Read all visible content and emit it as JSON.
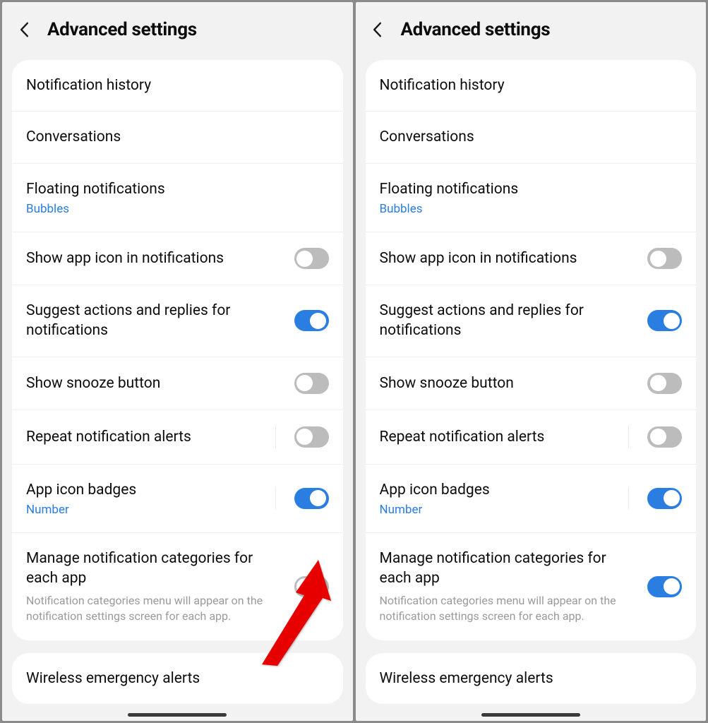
{
  "title": "Advanced settings",
  "items": [
    {
      "label": "Notification history",
      "sub": null,
      "desc": null,
      "toggle": null,
      "vsep": false
    },
    {
      "label": "Conversations",
      "sub": null,
      "desc": null,
      "toggle": null,
      "vsep": false
    },
    {
      "label": "Floating notifications",
      "sub": "Bubbles",
      "desc": null,
      "toggle": null,
      "vsep": false
    },
    {
      "label": "Show app icon in notifications",
      "sub": null,
      "desc": null,
      "toggle": "off",
      "vsep": false
    },
    {
      "label": "Suggest actions and replies for notifications",
      "sub": null,
      "desc": null,
      "toggle": "on",
      "vsep": false
    },
    {
      "label": "Show snooze button",
      "sub": null,
      "desc": null,
      "toggle": "off",
      "vsep": false
    },
    {
      "label": "Repeat notification alerts",
      "sub": null,
      "desc": null,
      "toggle": "off",
      "vsep": true
    },
    {
      "label": "App icon badges",
      "sub": "Number",
      "desc": null,
      "toggle": "on",
      "vsep": true
    },
    {
      "label": "Manage notification categories for each app",
      "sub": null,
      "desc": "Notification categories menu will appear on the notification settings screen for each app.",
      "toggle_left": "off",
      "toggle_right": "on",
      "vsep": false
    }
  ],
  "emergency": "Wireless emergency alerts"
}
